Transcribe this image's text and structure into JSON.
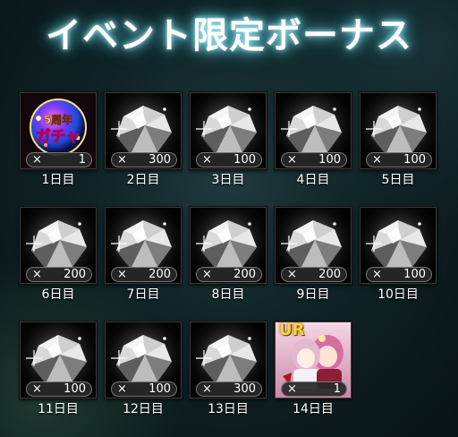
{
  "title": "イベント限定ボーナス",
  "multiplier": "×",
  "rewards": [
    {
      "day": "1日目",
      "amount": "1",
      "item": "gacha-ticket"
    },
    {
      "day": "2日目",
      "amount": "300",
      "item": "diamond"
    },
    {
      "day": "3日目",
      "amount": "100",
      "item": "diamond"
    },
    {
      "day": "4日目",
      "amount": "100",
      "item": "diamond"
    },
    {
      "day": "5日目",
      "amount": "100",
      "item": "diamond"
    },
    {
      "day": "6日目",
      "amount": "200",
      "item": "diamond"
    },
    {
      "day": "7日目",
      "amount": "200",
      "item": "diamond"
    },
    {
      "day": "8日目",
      "amount": "200",
      "item": "diamond"
    },
    {
      "day": "9日目",
      "amount": "200",
      "item": "diamond"
    },
    {
      "day": "10日目",
      "amount": "100",
      "item": "diamond"
    },
    {
      "day": "11日目",
      "amount": "100",
      "item": "diamond"
    },
    {
      "day": "12日目",
      "amount": "100",
      "item": "diamond"
    },
    {
      "day": "13日目",
      "amount": "300",
      "item": "diamond"
    },
    {
      "day": "14日目",
      "amount": "1",
      "item": "ur-character"
    }
  ],
  "gacha_ticket": {
    "line1": "5周年",
    "line2": "ガチャ"
  },
  "ur_badge": "UR",
  "colors": {
    "title_glow": "#6fe3f2",
    "ur_gold": "#ffd23c"
  }
}
